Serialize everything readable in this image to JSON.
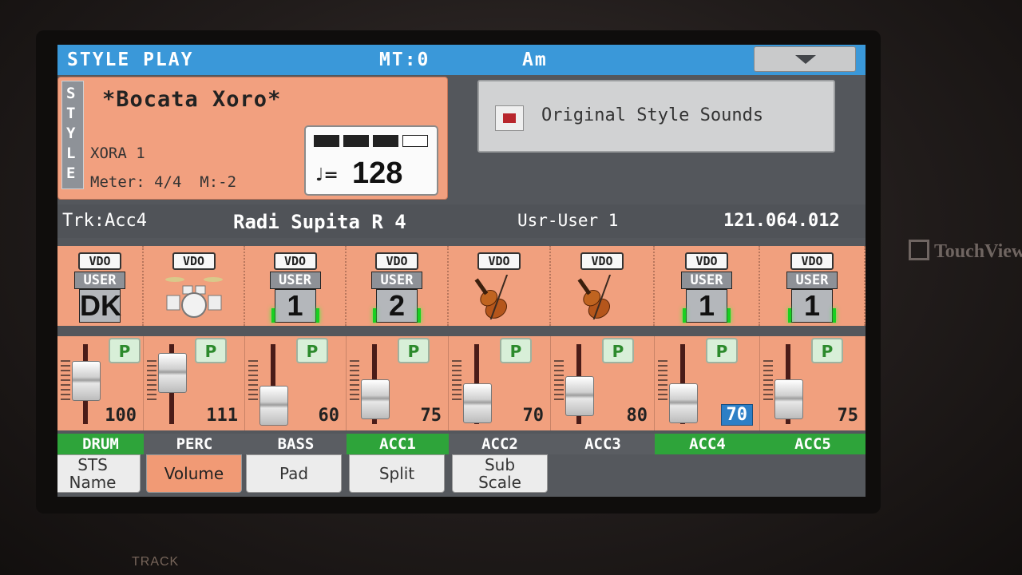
{
  "header": {
    "mode": "STYLE PLAY",
    "mt": "MT:0",
    "chord": "Am"
  },
  "style": {
    "tab_letters": [
      "S",
      "T",
      "Y",
      "L",
      "E"
    ],
    "name": "*Bocata Xoro*",
    "bank": "XORA 1",
    "meter": "Meter: 4/4  M:-2",
    "tempo_symbol": "♩=",
    "tempo": "128",
    "beats_filled": 3,
    "beats_total": 4
  },
  "original_sounds": {
    "label": "Original Style Sounds",
    "checked": true
  },
  "track_line": {
    "track": "Trk:Acc4",
    "sound": "Radi Supita R 4",
    "bank": "Usr-User 1",
    "address": "121.064.012"
  },
  "tracks": [
    {
      "label": "DRUM",
      "vdo": "VDO",
      "icon": "user",
      "user_tag": "USER",
      "user_num": "DK",
      "volume": "100",
      "active": true
    },
    {
      "label": "PERC",
      "vdo": "VDO",
      "icon": "drum-kit",
      "volume": "111",
      "active": false
    },
    {
      "label": "BASS",
      "vdo": "VDO",
      "icon": "user",
      "user_tag": "USER",
      "user_num": "1",
      "volume": "60",
      "active": false
    },
    {
      "label": "ACC1",
      "vdo": "VDO",
      "icon": "user",
      "user_tag": "USER",
      "user_num": "2",
      "volume": "75",
      "active": true
    },
    {
      "label": "ACC2",
      "vdo": "VDO",
      "icon": "violin",
      "volume": "70",
      "active": false
    },
    {
      "label": "ACC3",
      "vdo": "VDO",
      "icon": "violin",
      "volume": "80",
      "active": false
    },
    {
      "label": "ACC4",
      "vdo": "VDO",
      "icon": "user",
      "user_tag": "USER",
      "user_num": "1",
      "volume": "70",
      "active": true,
      "selected": true
    },
    {
      "label": "ACC5",
      "vdo": "VDO",
      "icon": "user",
      "user_tag": "USER",
      "user_num": "1",
      "volume": "75",
      "active": true
    }
  ],
  "pad_label": "P",
  "tabs": [
    {
      "label": "STS\nName",
      "active": false
    },
    {
      "label": "Volume",
      "active": true
    },
    {
      "label": "Pad",
      "active": false
    },
    {
      "label": "Split",
      "active": false
    },
    {
      "label": "Sub\nScale",
      "active": false
    }
  ],
  "brand": "TouchView",
  "track_button_label": "TRACK"
}
